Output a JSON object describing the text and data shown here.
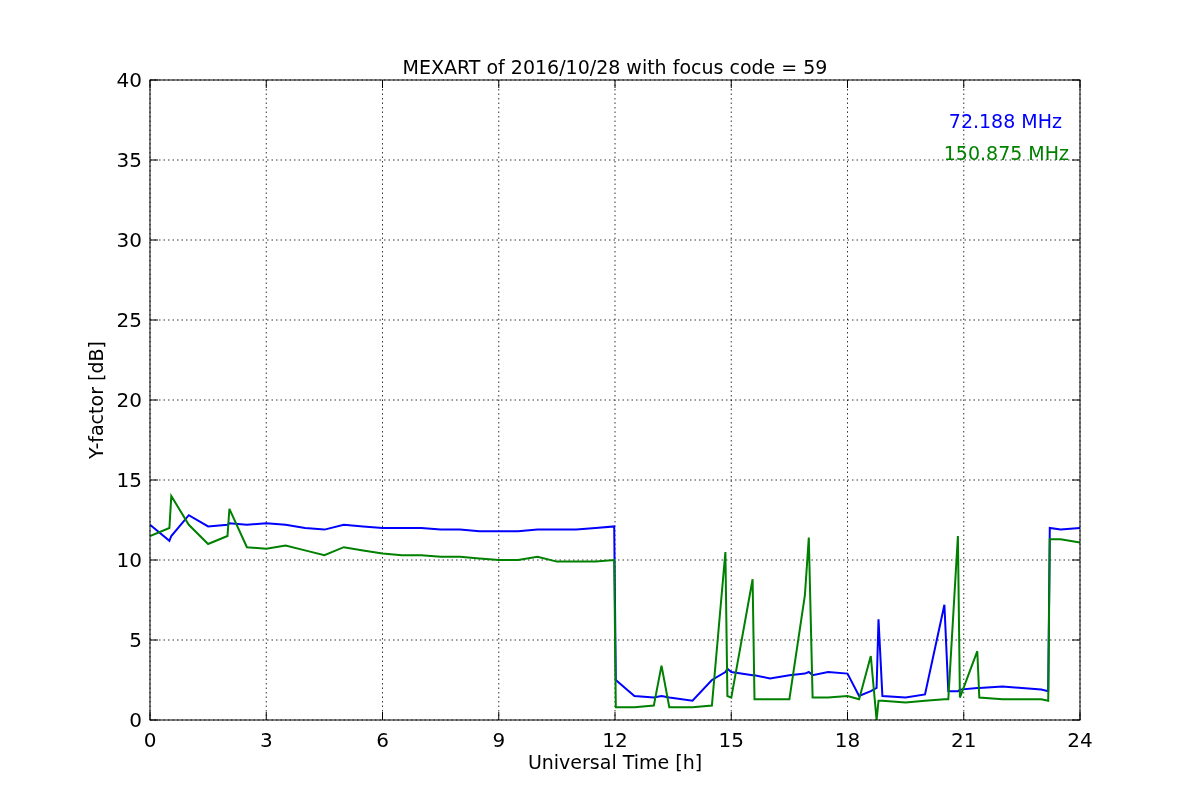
{
  "figure": {
    "chart_data": {
      "type": "line",
      "grid": true,
      "title": "MEXART of 2016/10/28 with focus code = 59",
      "xlabel": "Universal Time [h]",
      "ylabel": "Y-factor [dB]",
      "xlim": [
        0,
        24
      ],
      "ylim": [
        0,
        40
      ],
      "xticks": [
        0,
        3,
        6,
        9,
        12,
        15,
        18,
        21,
        24
      ],
      "yticks": [
        0,
        5,
        10,
        15,
        20,
        25,
        30,
        35,
        40
      ],
      "x": [
        0,
        0.5,
        0.55,
        1,
        1.5,
        2,
        2.05,
        2.5,
        3,
        3.5,
        4,
        4.5,
        5,
        5.5,
        6,
        6.5,
        7,
        7.5,
        8,
        8.5,
        9,
        9.5,
        10,
        10.5,
        11,
        11.5,
        11.98,
        12.02,
        12.5,
        13,
        13.2,
        13.4,
        14,
        14.5,
        14.85,
        14.9,
        15,
        15.55,
        15.6,
        16,
        16.5,
        16.9,
        17,
        17.1,
        17.5,
        18,
        18.3,
        18.6,
        18.75,
        18.8,
        18.9,
        19.5,
        20,
        20.5,
        20.6,
        20.85,
        20.9,
        21.35,
        21.4,
        22,
        22.5,
        23,
        23.18,
        23.22,
        23.5,
        24
      ],
      "series": [
        {
          "name": "72.188 MHz",
          "color": "#0000ff",
          "values": [
            12.2,
            11.2,
            11.5,
            12.8,
            12.1,
            12.2,
            12.3,
            12.2,
            12.3,
            12.2,
            12.0,
            11.9,
            12.2,
            12.1,
            12.0,
            12.0,
            12.0,
            11.9,
            11.9,
            11.8,
            11.8,
            11.8,
            11.9,
            11.9,
            11.9,
            12.0,
            12.1,
            2.5,
            1.5,
            1.4,
            1.5,
            1.4,
            1.2,
            2.5,
            3.0,
            3.2,
            3.0,
            2.8,
            2.8,
            2.6,
            2.8,
            2.9,
            3.0,
            2.8,
            3.0,
            2.9,
            1.5,
            1.8,
            2.0,
            6.3,
            1.5,
            1.4,
            1.6,
            7.2,
            1.8,
            1.8,
            1.9,
            2.0,
            2.0,
            2.1,
            2.0,
            1.9,
            1.8,
            12.0,
            11.9,
            12.0
          ]
        },
        {
          "name": "150.875 MHz",
          "color": "#008000",
          "values": [
            11.5,
            12.0,
            14.0,
            12.2,
            11.0,
            11.5,
            13.2,
            10.8,
            10.7,
            10.9,
            10.6,
            10.3,
            10.8,
            10.6,
            10.4,
            10.3,
            10.3,
            10.2,
            10.2,
            10.1,
            10.0,
            10.0,
            10.2,
            9.9,
            9.9,
            9.9,
            10.0,
            0.8,
            0.8,
            0.9,
            3.4,
            0.8,
            0.8,
            0.9,
            10.5,
            1.5,
            1.4,
            8.8,
            1.3,
            1.3,
            1.3,
            7.8,
            11.4,
            1.4,
            1.4,
            1.5,
            1.3,
            4.0,
            0.0,
            1.2,
            1.2,
            1.1,
            1.2,
            1.3,
            1.3,
            11.5,
            1.4,
            4.3,
            1.4,
            1.3,
            1.3,
            1.3,
            1.2,
            11.3,
            11.3,
            11.1
          ]
        }
      ]
    }
  }
}
